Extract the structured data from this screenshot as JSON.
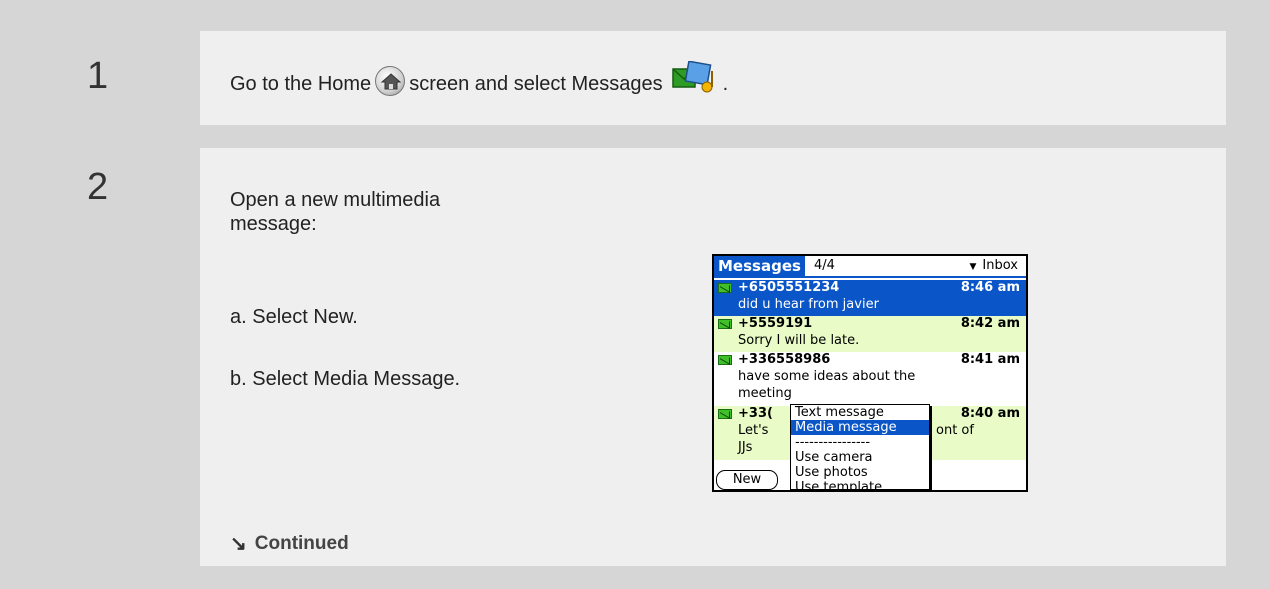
{
  "steps": [
    {
      "number": "1",
      "text_before_home": "Go to the Home",
      "text_after_home": "screen and select Messages",
      "text_end": "."
    },
    {
      "number": "2",
      "intro": "Open a new multimedia message:",
      "step_a": "a.  Select New.",
      "step_b": "b.  Select Media Message.",
      "continued": "Continued"
    }
  ],
  "palm": {
    "title": "Messages",
    "count": "4/4",
    "folder": "Inbox",
    "messages": [
      {
        "number": "+6505551234",
        "time": "8:46 am",
        "text": "did u hear from javier"
      },
      {
        "number": "+5559191",
        "time": "8:42 am",
        "text": "Sorry I will be late."
      },
      {
        "number": "+336558986",
        "time": "8:41 am",
        "text": "have some ideas about the",
        "text2": "meeting"
      },
      {
        "number": "+33(",
        "time": "8:40 am",
        "text": "Let's",
        "text_right": "ont of",
        "text2": "JJs"
      }
    ],
    "menu": [
      "Text message",
      "Media message",
      "----------------",
      "Use camera",
      "Use photos",
      "Use template"
    ],
    "new_button": "New"
  },
  "colors": {
    "outer_bg": "#d6d6d6",
    "step_bg": "#efefef",
    "palm_blue": "#0a55c7",
    "row_green": "#e9fbc6"
  },
  "icons": [
    "home-icon",
    "messages-app-icon",
    "continued-arrow-icon",
    "envelope-icon"
  ]
}
